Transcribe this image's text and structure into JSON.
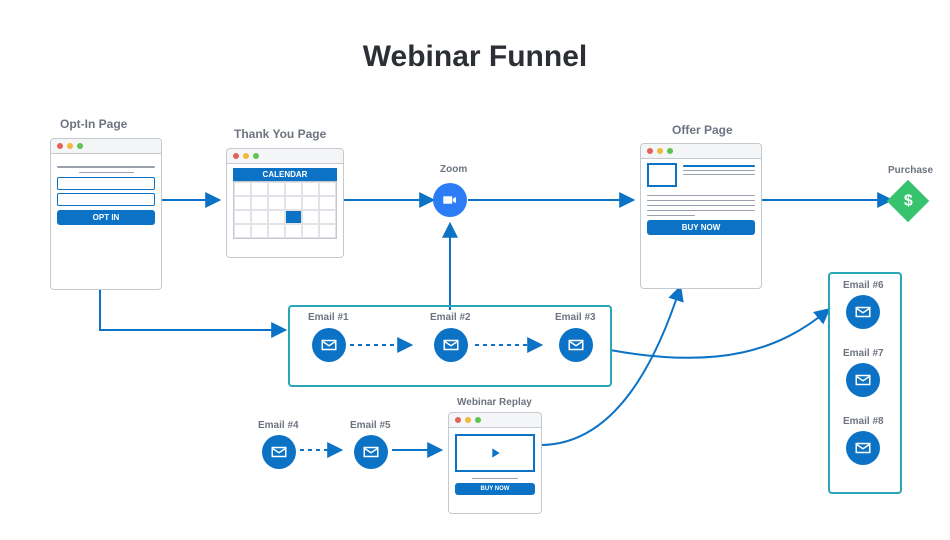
{
  "title": "Webinar Funnel",
  "nodes": {
    "optin": {
      "label": "Opt-In Page",
      "button": "OPT IN"
    },
    "thanks": {
      "label": "Thank You Page",
      "calendar": "CALENDAR"
    },
    "zoom": {
      "label": "Zoom"
    },
    "offer": {
      "label": "Offer Page",
      "button": "BUY NOW"
    },
    "purchase": {
      "label": "Purchase"
    },
    "replay": {
      "label": "Webinar Replay",
      "button": "BUY NOW"
    }
  },
  "emails_row1": [
    {
      "label": "Email #1"
    },
    {
      "label": "Email #2"
    },
    {
      "label": "Email #3"
    }
  ],
  "emails_row2": [
    {
      "label": "Email #4"
    },
    {
      "label": "Email #5"
    }
  ],
  "emails_col": [
    {
      "label": "Email #6"
    },
    {
      "label": "Email #7"
    },
    {
      "label": "Email #8"
    }
  ],
  "colors": {
    "primary": "#0b72c5",
    "teal": "#2aa6b8",
    "green": "#37c36e"
  }
}
